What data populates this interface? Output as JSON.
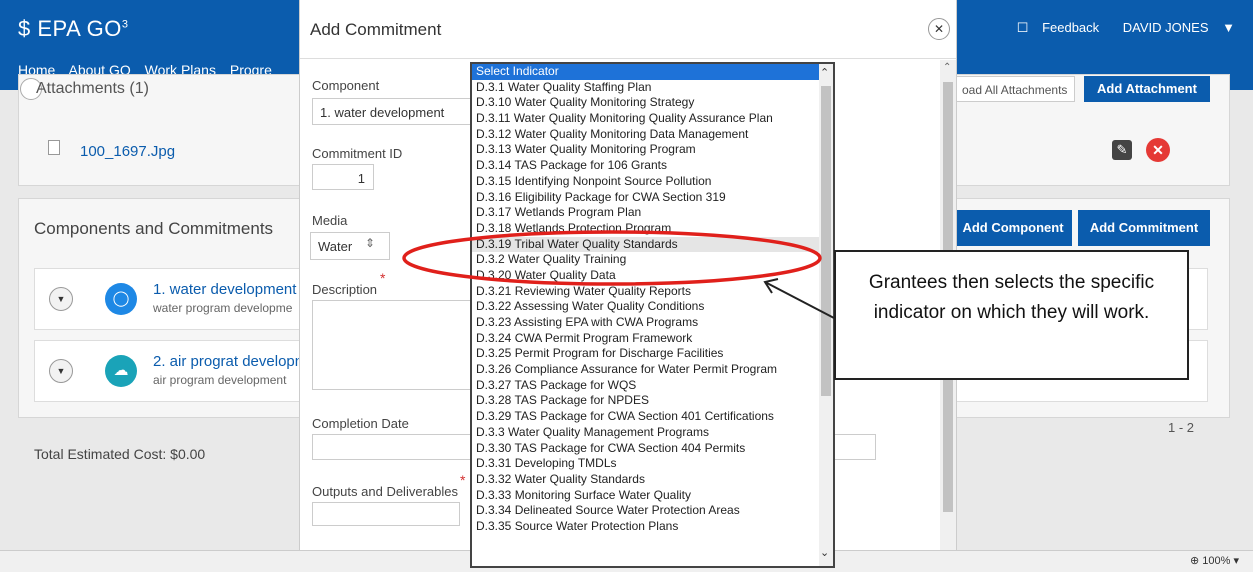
{
  "header": {
    "logo": "EPA GO",
    "logo_sup": "3",
    "nav": [
      "Home",
      "About GO",
      "Work Plans",
      "Progre"
    ],
    "feedback": "Feedback",
    "user": "DAVID JONES"
  },
  "attachments": {
    "title": "Attachments (1)",
    "file": "100_1697.Jpg",
    "download_all": "oad All Attachments",
    "add_button": "Add Attachment"
  },
  "components_section": {
    "title": "Components and Commitments",
    "add_component": "Add Component",
    "add_commitment": "Add Commitment",
    "rows": [
      {
        "name": "1. water development",
        "sub": "water program developme"
      },
      {
        "name": "2. air prograt developn",
        "sub": "air program development"
      }
    ],
    "pager": "1 - 2",
    "total": "Total Estimated Cost:  $0.00"
  },
  "status": {
    "zoom": "100%"
  },
  "modal": {
    "title": "Add Commitment",
    "component_label": "Component",
    "component_value": "1. water development",
    "commitment_id_label": "Commitment ID",
    "commitment_id_value": "1",
    "media_label": "Media",
    "media_value": "Water",
    "description_label": "Description",
    "completion_label": "Completion Date",
    "outputs_label": "Outputs and Deliverables",
    "required_mark": "*"
  },
  "indicator_dropdown": {
    "selected": "Select Indicator",
    "highlighted": "D.3.19 Tribal Water Quality Standards",
    "options": [
      "Select Indicator",
      "D.3.1 Water Quality Staffing Plan",
      "D.3.10 Water Quality Monitoring Strategy",
      "D.3.11 Water Quality Monitoring Quality Assurance Plan",
      "D.3.12 Water Quality Monitoring Data Management",
      "D.3.13 Water Quality Monitoring Program",
      "D.3.14 TAS Package for 106 Grants",
      "D.3.15 Identifying Nonpoint Source Pollution",
      "D.3.16 Eligibility Package for CWA Section 319",
      "D.3.17 Wetlands Program Plan",
      "D.3.18 Wetlands Protection Program",
      "D.3.19 Tribal Water Quality Standards",
      "D.3.2 Water Quality Training",
      "D.3.20 Water Quality Data",
      "D.3.21 Reviewing Water Quality Reports",
      "D.3.22 Assessing Water Quality Conditions",
      "D.3.23 Assisting EPA with CWA Programs",
      "D.3.24 CWA Permit Program Framework",
      "D.3.25 Permit Program for Discharge Facilities",
      "D.3.26 Compliance Assurance for Water Permit Program",
      "D.3.27 TAS Package for WQS",
      "D.3.28 TAS Package for NPDES",
      "D.3.29 TAS Package for CWA Section 401 Certifications",
      "D.3.3 Water Quality Management Programs",
      "D.3.30 TAS Package for CWA Section 404 Permits",
      "D.3.31 Developing TMDLs",
      "D.3.32 Water Quality Standards",
      "D.3.33 Monitoring Surface Water Quality",
      "D.3.34 Delineated Source Water Protection Areas",
      "D.3.35 Source Water Protection Plans"
    ]
  },
  "annotation": {
    "callout_text": "Grantees then selects the specific indicator on which they will work.",
    "circle_color": "#e0201b"
  }
}
